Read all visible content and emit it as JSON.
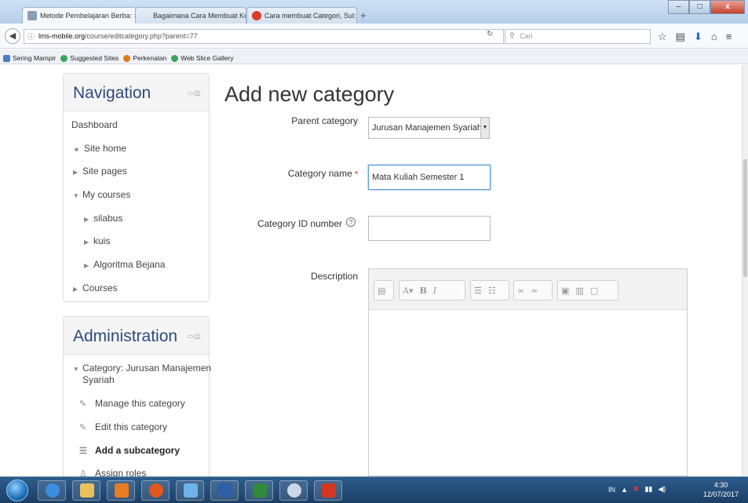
{
  "browser": {
    "tabs": [
      {
        "title": "Metode Pembelajaran Berba: ×"
      },
      {
        "title": "Bagaimana Cara Membuat Kurs: ×"
      },
      {
        "title": "Cara membuat Categori, Sul: ×"
      }
    ],
    "new_tab": "+",
    "url_prefix": "ⓘ",
    "url_domain": "lms-mobile.org",
    "url_path": "/course/editcategory.php?parent=77",
    "search_placeholder": "Cari",
    "bookmarks": [
      "Sering Mampir",
      "Suggested Sites",
      "Perkenalan",
      "Web Slice Gallery"
    ],
    "window_buttons": {
      "min": "–",
      "max": "□",
      "close": "x"
    }
  },
  "navigation": {
    "title": "Navigation",
    "items": [
      {
        "label": "Dashboard"
      },
      {
        "label": "Site home"
      },
      {
        "label": "Site pages"
      },
      {
        "label": "My courses"
      },
      {
        "label": "silabus"
      },
      {
        "label": "kuis"
      },
      {
        "label": "Algoritma Bejana"
      },
      {
        "label": "Courses"
      }
    ]
  },
  "administration": {
    "title": "Administration",
    "items": [
      {
        "label": "Category: Jurusan Manajemen"
      },
      {
        "label": "Syariah"
      },
      {
        "label": "Manage this category"
      },
      {
        "label": "Edit this category"
      },
      {
        "label": "Add a subcategory"
      },
      {
        "label": "Assign roles"
      }
    ]
  },
  "form": {
    "title": "Add new category",
    "parent_label": "Parent category",
    "parent_value": "Jurusan Manajemen Syariah",
    "name_label": "Category name",
    "required_mark": "*",
    "name_value": "Mata Kuliah Semester 1",
    "idnumber_label": "Category ID number",
    "idnumber_value": "",
    "description_label": "Description"
  },
  "taskbar": {
    "tray_lang": "IN",
    "time": "4:30",
    "date": "12/07/2017"
  },
  "colors": {
    "block_title": "#2c4a7a",
    "required": "#cc0000",
    "taskbar": "#1b3f66"
  }
}
